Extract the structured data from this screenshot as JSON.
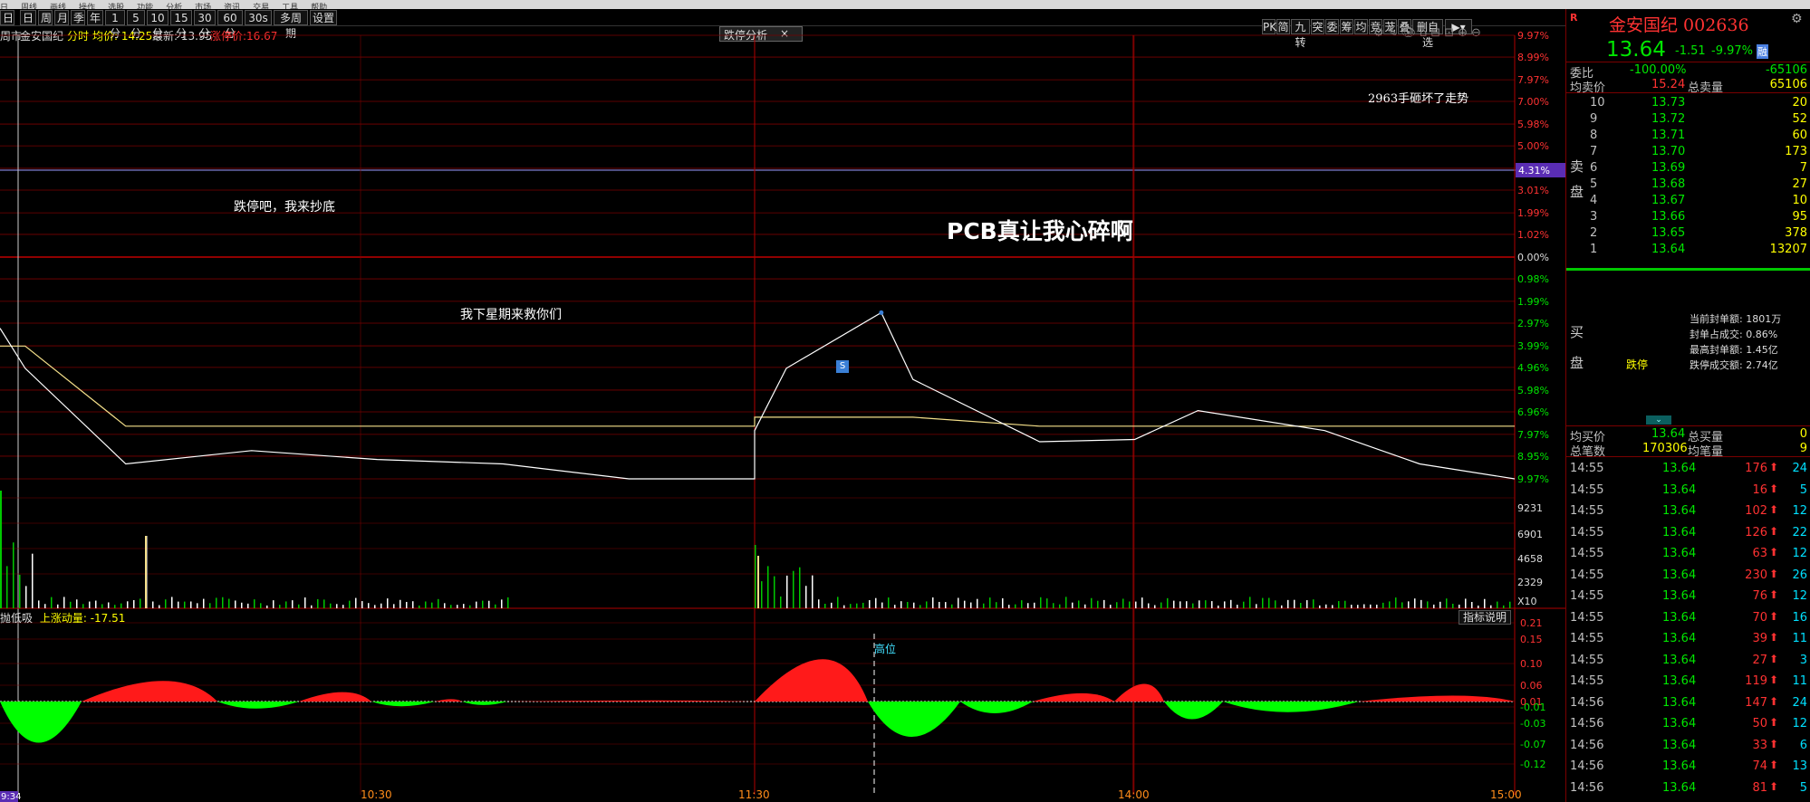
{
  "menu_strip": [
    "日",
    "周线",
    "画线",
    "操作",
    "选股",
    "功能",
    "分析",
    "市场",
    "资讯",
    "交易",
    "工具",
    "帮助"
  ],
  "toolbar": {
    "items": [
      "日",
      "日",
      "周",
      "月",
      "季",
      "年",
      "1分",
      "5分",
      "10分",
      "15分",
      "30分",
      "60分",
      "30s",
      "多周期",
      "设置"
    ],
    "right_items": [
      "PK",
      "简",
      "九转",
      "突",
      "委",
      "筹",
      "均",
      "竞",
      "茏",
      "叠",
      "删自选"
    ]
  },
  "chart_header": {
    "market": "周市",
    "stock": "金安国纪",
    "mode": "分时",
    "avg_label": "均价: 14.25",
    "last_label": "最新: 13.95",
    "limit_label": "涨停价:16.67",
    "tab_label": "跌停分析",
    "tab_close": "×"
  },
  "annotations": {
    "a1": "跌停吧，我来抄底",
    "a2": "PCB真让我心碎啊",
    "a3": "我下星期来救你们",
    "a4": "2963手砸坏了走势",
    "marker_s": "S",
    "gaowei": "高位"
  },
  "axis": {
    "pct": [
      "9.97%",
      "8.99%",
      "7.97%",
      "7.00%",
      "5.98%",
      "5.00%",
      "3.99%",
      "3.01%",
      "1.99%",
      "1.02%",
      "0.00%",
      "0.98%",
      "1.99%",
      "2.97%",
      "3.99%",
      "4.96%",
      "5.98%",
      "6.96%",
      "7.97%",
      "8.95%",
      "9.97%"
    ],
    "crosshair_pct": "4.31%",
    "vol": [
      "9231",
      "6901",
      "4658",
      "2329",
      "X10"
    ],
    "ind": [
      "0.21",
      "0.15",
      "0.10",
      "0.06",
      "0.01",
      "-0.01",
      "-0.03",
      "-0.07",
      "-0.12"
    ],
    "time": [
      "10:30",
      "11:30",
      "14:00",
      "15:00"
    ],
    "time_start": "9:34"
  },
  "indicator": {
    "name": "抛低吸",
    "label": "上涨动量: -17.51",
    "help": "指标说明"
  },
  "panel": {
    "logo": "R",
    "name": "金安国纪 002636",
    "price": "13.64",
    "change": "-1.51",
    "change_pct": "-9.97%",
    "badge": "融",
    "weibi_label": "委比",
    "weibi": "-100.00%",
    "weicha": "-65106",
    "avg_sell_label": "均卖价",
    "avg_sell": "15.24",
    "total_sell_label": "总卖量",
    "total_sell": "65106",
    "sell_side": [
      "卖",
      "盘"
    ],
    "asks": [
      {
        "lvl": "10",
        "price": "13.73",
        "vol": "20"
      },
      {
        "lvl": "9",
        "price": "13.72",
        "vol": "52"
      },
      {
        "lvl": "8",
        "price": "13.71",
        "vol": "60"
      },
      {
        "lvl": "7",
        "price": "13.70",
        "vol": "173"
      },
      {
        "lvl": "6",
        "price": "13.69",
        "vol": "7"
      },
      {
        "lvl": "5",
        "price": "13.68",
        "vol": "27"
      },
      {
        "lvl": "4",
        "price": "13.67",
        "vol": "10"
      },
      {
        "lvl": "3",
        "price": "13.66",
        "vol": "95"
      },
      {
        "lvl": "2",
        "price": "13.65",
        "vol": "378"
      },
      {
        "lvl": "1",
        "price": "13.64",
        "vol": "13207"
      }
    ],
    "buy_side": [
      "买",
      "盘"
    ],
    "limit_word": "跌停",
    "seal_info": [
      "当前封单额: 1801万",
      "封单占成交: 0.86%",
      "最高封单额: 1.45亿",
      "跌停成交额: 2.74亿"
    ],
    "avg_buy_label": "均买价",
    "avg_buy": "13.64",
    "total_buy_label": "总买量",
    "total_buy": "0",
    "total_trades_label": "总笔数",
    "total_trades": "170306",
    "avg_trade_label": "均笔量",
    "avg_trade": "9",
    "ticks": [
      {
        "t": "14:55",
        "p": "13.64",
        "v": "176",
        "n": "24"
      },
      {
        "t": "14:55",
        "p": "13.64",
        "v": "16",
        "n": "5"
      },
      {
        "t": "14:55",
        "p": "13.64",
        "v": "102",
        "n": "12"
      },
      {
        "t": "14:55",
        "p": "13.64",
        "v": "126",
        "n": "22"
      },
      {
        "t": "14:55",
        "p": "13.64",
        "v": "63",
        "n": "12"
      },
      {
        "t": "14:55",
        "p": "13.64",
        "v": "230",
        "n": "26"
      },
      {
        "t": "14:55",
        "p": "13.64",
        "v": "76",
        "n": "12"
      },
      {
        "t": "14:55",
        "p": "13.64",
        "v": "70",
        "n": "16"
      },
      {
        "t": "14:55",
        "p": "13.64",
        "v": "39",
        "n": "11"
      },
      {
        "t": "14:55",
        "p": "13.64",
        "v": "27",
        "n": "3"
      },
      {
        "t": "14:55",
        "p": "13.64",
        "v": "119",
        "n": "11"
      },
      {
        "t": "14:56",
        "p": "13.64",
        "v": "147",
        "n": "24"
      },
      {
        "t": "14:56",
        "p": "13.64",
        "v": "50",
        "n": "12"
      },
      {
        "t": "14:56",
        "p": "13.64",
        "v": "33",
        "n": "6"
      },
      {
        "t": "14:56",
        "p": "13.64",
        "v": "74",
        "n": "13"
      },
      {
        "t": "14:56",
        "p": "13.64",
        "v": "81",
        "n": "5"
      }
    ]
  },
  "colors": {
    "up": "#ff3232",
    "down": "#00e600",
    "grid": "#7a0000",
    "price_line": "#ffffff",
    "avg_line": "#f5e08a",
    "accent_purple": "#5a2db4"
  },
  "chart_data": {
    "type": "line",
    "series": [
      {
        "x": [
          "9:30",
          "9:34",
          "9:50",
          "10:10",
          "10:30",
          "10:50",
          "11:10",
          "11:30",
          "13:00",
          "13:05",
          "13:20",
          "13:25",
          "13:45",
          "14:00",
          "14:10",
          "14:30",
          "14:45",
          "15:00"
        ],
        "values": [
          -3.2,
          -5.0,
          -9.3,
          -8.7,
          -9.1,
          -9.3,
          -9.97,
          -9.97,
          -7.8,
          -5.0,
          -2.5,
          -5.5,
          -8.3,
          -8.2,
          -6.9,
          -7.8,
          -9.3,
          -9.97
        ]
      }
    ],
    "ylim": [
      -9.97,
      9.97
    ]
  }
}
